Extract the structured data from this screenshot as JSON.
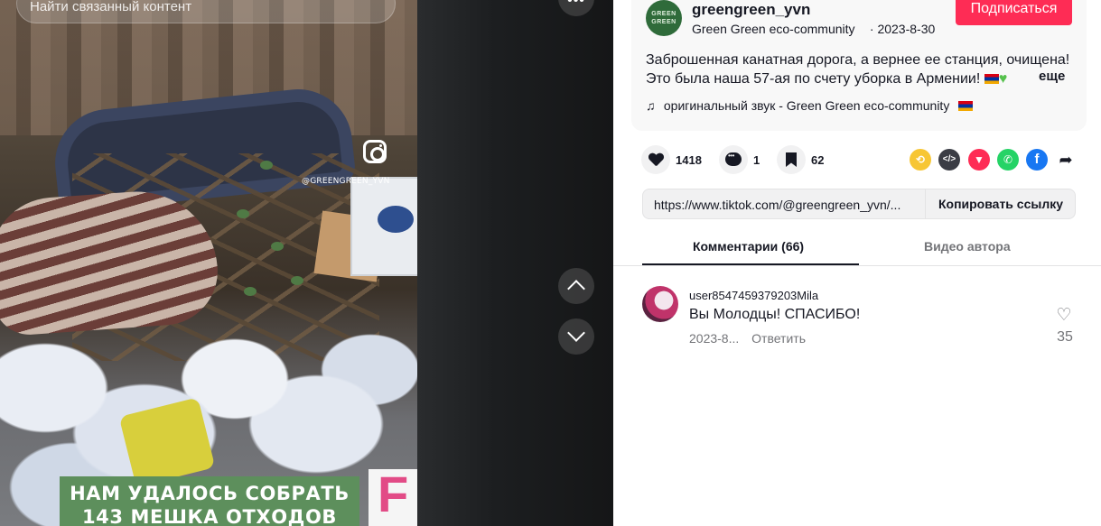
{
  "search": {
    "placeholder": "Найти связанный контент"
  },
  "video": {
    "watermark_handle": "@GREENGREEN_YVN",
    "caption_lines": [
      "НАМ УДАЛОСЬ СОБРАТЬ",
      "143 МЕШКА ОТХОДОВ"
    ],
    "more_label": "•••"
  },
  "author": {
    "avatar_text": "GREEN GREEN",
    "username": "greengreen_yvn",
    "nickname": "Green  Green  eco-community",
    "date": "· 2023-8-30",
    "follow_label": "Подписаться"
  },
  "post": {
    "desc_line1": "Заброшенная канатная дорога, а вернее ее станция, очищена!",
    "desc_line2": "Это была наша 57-ая по счету уборка в Армении!",
    "more_label": "еще",
    "sound": "оригинальный звук - Green  Green  eco-community"
  },
  "actions": {
    "likes": "1418",
    "comments": "1",
    "saves": "62"
  },
  "share": {
    "link": "https://www.tiktok.com/@greengreen_yvn/...",
    "copy_label": "Копировать ссылку"
  },
  "tabs": {
    "comments": "Комментарии (66)",
    "videos": "Видео автора"
  },
  "comment": {
    "user": "user8547459379203Mila",
    "text": "Вы Молодцы! СПАСИБО!",
    "date": "2023-8...",
    "reply_label": "Ответить",
    "likes": "35"
  },
  "colors": {
    "follow": "#fe2c55",
    "caption_bg": "#5d8f5c",
    "accent_green": "#56c14d"
  },
  "icons": [
    "search-icon",
    "instagram-icon",
    "chevron-up-icon",
    "chevron-down-icon",
    "heart-icon",
    "comment-icon",
    "bookmark-icon",
    "repost-icon",
    "embed-icon",
    "send-icon",
    "whatsapp-icon",
    "facebook-icon",
    "forward-icon",
    "music-note-icon"
  ]
}
